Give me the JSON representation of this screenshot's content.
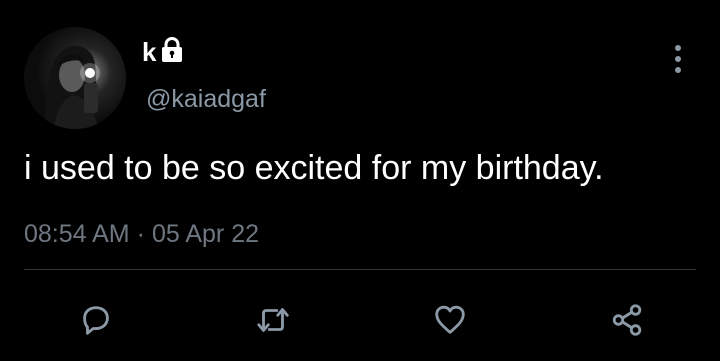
{
  "author": {
    "display_name": "k",
    "handle": "@kaiadgaf",
    "protected_icon": "lock-icon",
    "avatar": "profile-photo"
  },
  "tweet": {
    "text": "i used to be so excited for my birthday.",
    "time": "08:54 AM",
    "separator": "·",
    "date": "05 Apr 22"
  },
  "actions": [
    {
      "name": "reply",
      "icon": "reply-icon"
    },
    {
      "name": "retweet",
      "icon": "retweet-icon"
    },
    {
      "name": "like",
      "icon": "heart-icon"
    },
    {
      "name": "share",
      "icon": "share-icon"
    }
  ],
  "colors": {
    "background": "#000000",
    "primary_text": "#ffffff",
    "secondary_text": "#8b98a5",
    "icon": "#8b98a5",
    "divider": "#2f3336"
  }
}
